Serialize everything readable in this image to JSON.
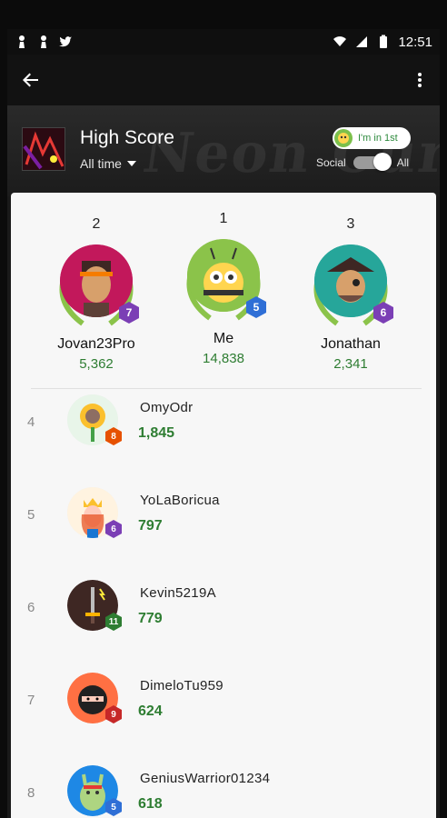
{
  "status": {
    "time": "12:51"
  },
  "header": {
    "title": "High Score",
    "time_filter": "All time",
    "rank_pill": "I'm in 1st",
    "social_label": "Social",
    "all_label": "All",
    "background_text": "Neon Curve"
  },
  "podium": [
    {
      "rank": "2",
      "name": "Jovan23Pro",
      "score": "5,362",
      "level": "7",
      "level_color": "#7b3fb5",
      "avatar_color": "#c2185b"
    },
    {
      "rank": "1",
      "name": "Me",
      "score": "14,838",
      "level": "5",
      "level_color": "#2f6fd6",
      "avatar_color": "#8bc34a"
    },
    {
      "rank": "3",
      "name": "Jonathan",
      "score": "2,341",
      "level": "6",
      "level_color": "#7b3fb5",
      "avatar_color": "#26a69a"
    }
  ],
  "rows": [
    {
      "rank": "4",
      "name": "OmyOdr",
      "score": "1,845",
      "level": "8",
      "level_color": "#e65100",
      "avatar": "sunflower"
    },
    {
      "rank": "5",
      "name": "YoLaBoricua",
      "score": "797",
      "level": "6",
      "level_color": "#7b3fb5",
      "avatar": "queen"
    },
    {
      "rank": "6",
      "name": "Kevin5219A",
      "score": "779",
      "level": "11",
      "level_color": "#2e7d32",
      "avatar": "sword"
    },
    {
      "rank": "7",
      "name": "DimeloTu959",
      "score": "624",
      "level": "9",
      "level_color": "#c62828",
      "avatar": "ninja"
    },
    {
      "rank": "8",
      "name": "GeniusWarrior01234",
      "score": "618",
      "level": "5",
      "level_color": "#2f6fd6",
      "avatar": "llama"
    }
  ]
}
